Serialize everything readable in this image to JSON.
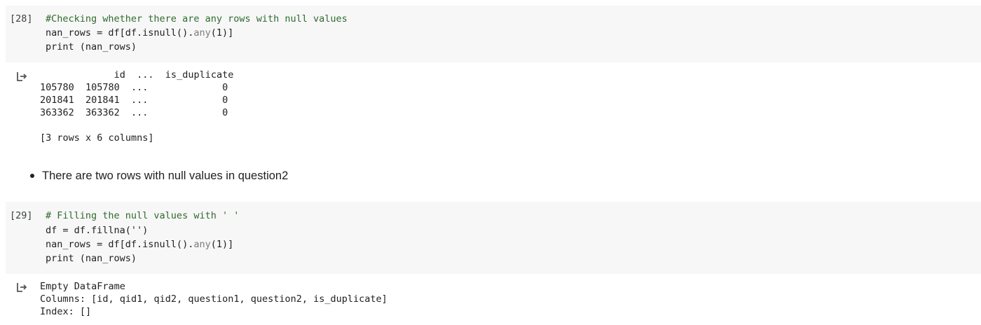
{
  "cells": [
    {
      "execution_count": "[28]",
      "code_lines": [
        {
          "text": "#Checking whether there are any rows with null values",
          "kind": "comment"
        },
        {
          "parts": [
            "nan_rows = df[df.isnull().",
            "any",
            "(1)]"
          ]
        },
        {
          "text": "print (nan_rows)",
          "kind": "code"
        }
      ],
      "output_icon": "output-arrow-icon",
      "output_lines": [
        "             id  ...  is_duplicate",
        "105780  105780  ...             0",
        "201841  201841  ...             0",
        "363362  363362  ...             0",
        "",
        "[3 rows x 6 columns]"
      ]
    },
    {
      "execution_count": "[29]",
      "code_lines": [
        {
          "text": "# Filling the null values with ' '",
          "kind": "comment"
        },
        {
          "text": "df = df.fillna('')",
          "kind": "code"
        },
        {
          "parts": [
            "nan_rows = df[df.isnull().",
            "any",
            "(1)]"
          ]
        },
        {
          "text": "print (nan_rows)",
          "kind": "code"
        }
      ],
      "output_icon": "output-arrow-icon",
      "output_lines": [
        "Empty DataFrame",
        "Columns: [id, qid1, qid2, question1, question2, is_duplicate]",
        "Index: []"
      ]
    }
  ],
  "markdown": {
    "bullet_text": "There are two rows with null values in question2"
  },
  "colors": {
    "cell_background": "#f7f7f7",
    "comment": "#2e6b2e",
    "builtin": "#7d7d7d"
  }
}
